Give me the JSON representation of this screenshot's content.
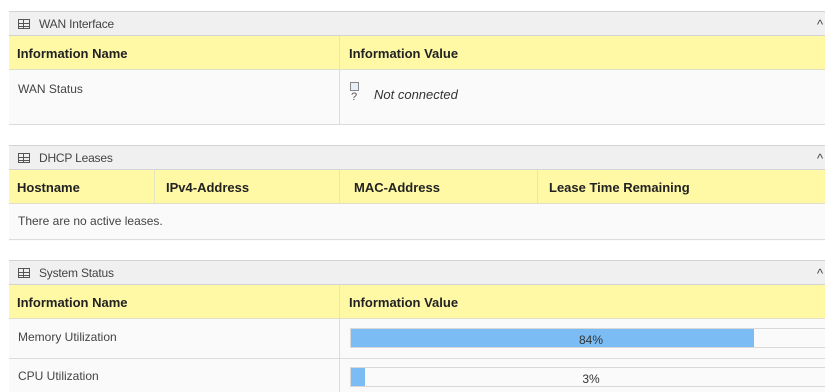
{
  "wan": {
    "title": "WAN Interface",
    "headers": [
      "Information Name",
      "Information Value"
    ],
    "row": {
      "name": "WAN Status",
      "value": "Not connected",
      "icon_q": "?"
    }
  },
  "dhcp": {
    "title": "DHCP Leases",
    "headers": [
      "Hostname",
      "IPv4-Address",
      "MAC-Address",
      "Lease Time Remaining"
    ],
    "empty": "There are no active leases."
  },
  "system": {
    "title": "System Status",
    "headers": [
      "Information Name",
      "Information Value"
    ],
    "rows": [
      {
        "name": "Memory Utilization",
        "percent": 84,
        "label": "84%"
      },
      {
        "name": "CPU Utilization",
        "percent": 3,
        "label": "3%"
      }
    ]
  },
  "collapse_glyph": "^",
  "colors": {
    "header_bg": "#fff9a6",
    "bar_fill": "#7cbcf5",
    "panel_header_bg": "#f0f0f0"
  }
}
